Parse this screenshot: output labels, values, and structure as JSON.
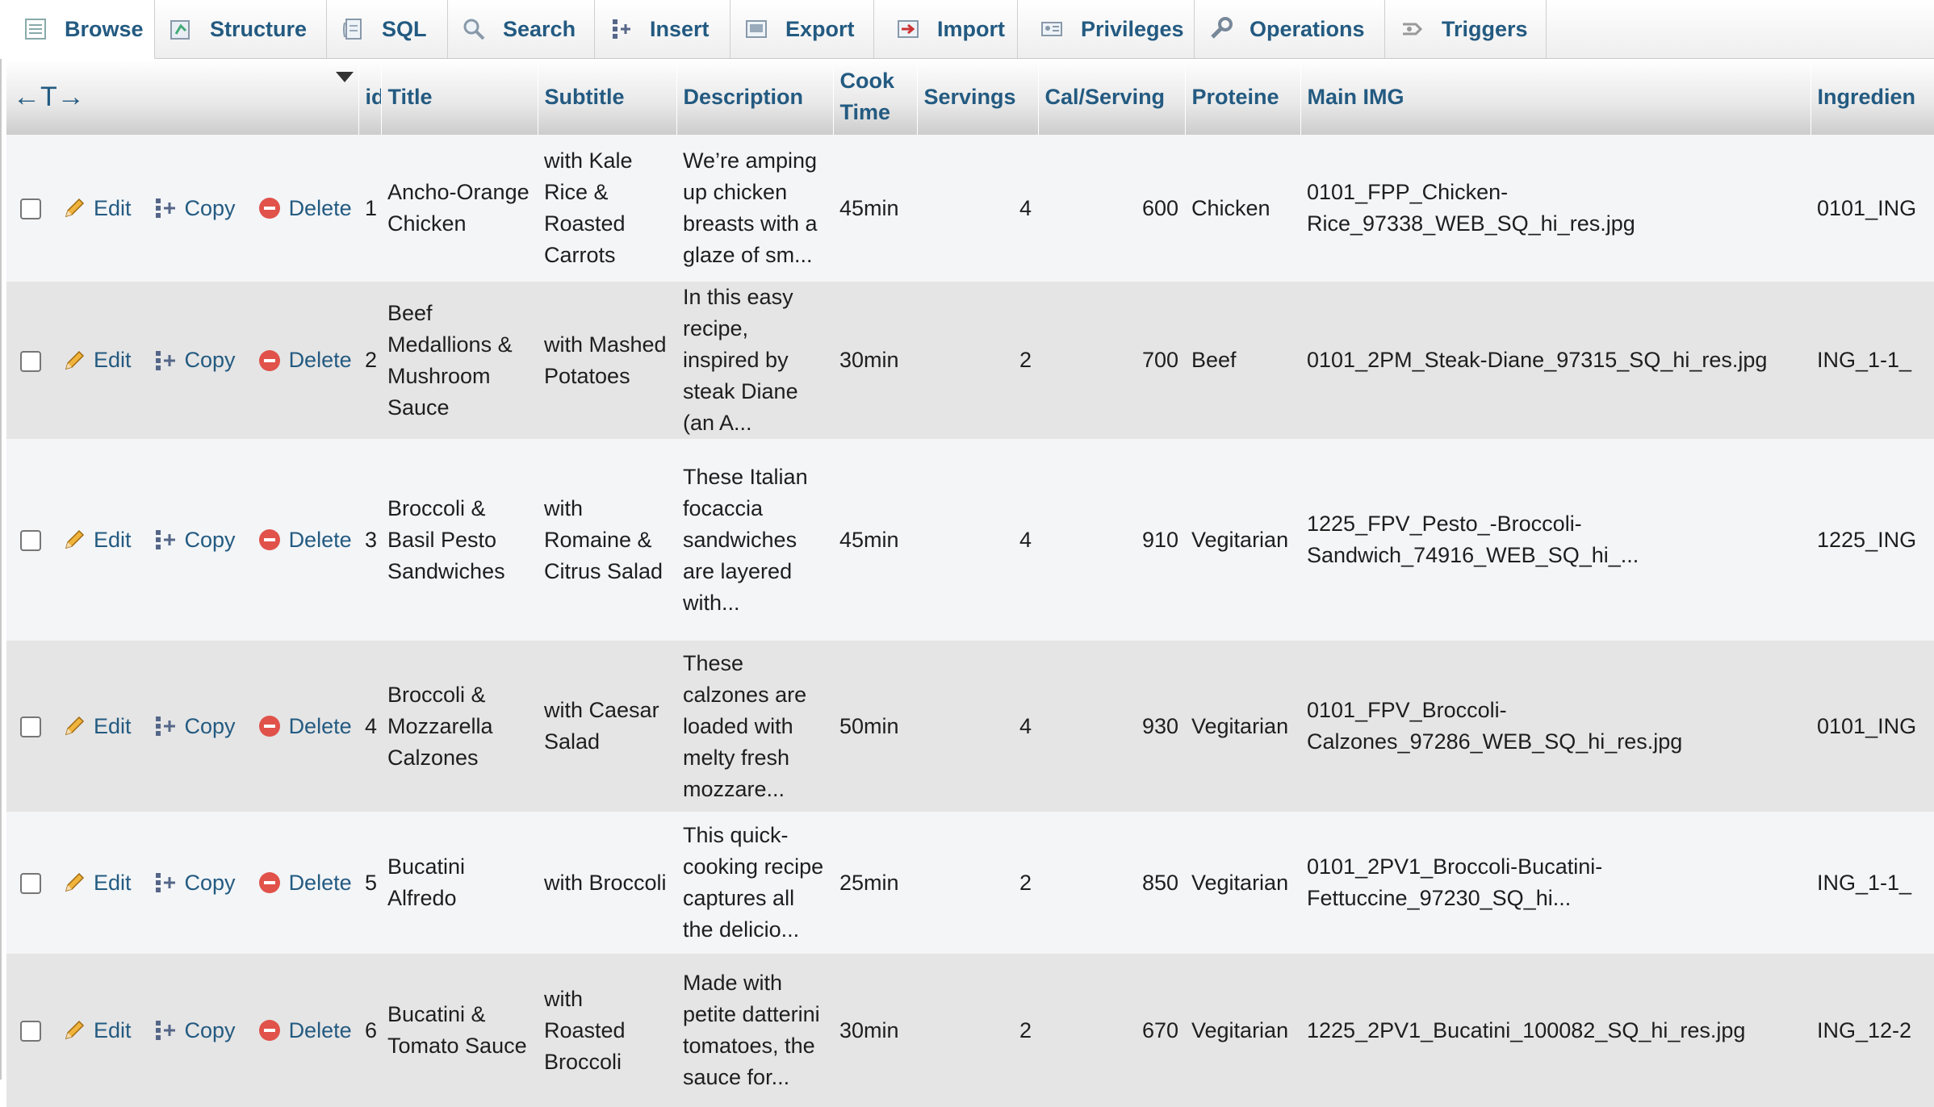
{
  "tabs": [
    {
      "label": "Browse",
      "icon": "browse-icon",
      "active": true
    },
    {
      "label": "Structure",
      "icon": "structure-icon"
    },
    {
      "label": "SQL",
      "icon": "sql-icon"
    },
    {
      "label": "Search",
      "icon": "search-icon"
    },
    {
      "label": "Insert",
      "icon": "insert-icon"
    },
    {
      "label": "Export",
      "icon": "export-icon"
    },
    {
      "label": "Import",
      "icon": "import-icon"
    },
    {
      "label": "Privileges",
      "icon": "privileges-icon"
    },
    {
      "label": "Operations",
      "icon": "operations-icon"
    },
    {
      "label": "Triggers",
      "icon": "triggers-icon"
    }
  ],
  "table": {
    "resize_glyph": "←T→",
    "columns": {
      "id": "id",
      "title": "Title",
      "subtitle": "Subtitle",
      "description": "Description",
      "cook_time": "Cook Time",
      "servings": "Servings",
      "cal_serving": "Cal/Serving",
      "proteine": "Proteine",
      "main_img": "Main IMG",
      "ingredients": "Ingredien"
    },
    "actions": {
      "edit": "Edit",
      "copy": "Copy",
      "delete": "Delete"
    },
    "rows": [
      {
        "id": "1",
        "title": "Ancho-Orange Chicken",
        "subtitle": "with Kale Rice & Roasted Carrots",
        "description": "We’re amping up chicken breasts with a glaze of sm...",
        "cook_time": "45min",
        "servings": "4",
        "cal": "600",
        "proteine": "Chicken",
        "main_img": "0101_FPP_Chicken-Rice_97338_WEB_SQ_hi_res.jpg",
        "ingredients": "0101_ING"
      },
      {
        "id": "2",
        "title": "Beef Medallions & Mushroom Sauce",
        "subtitle": "with Mashed Potatoes",
        "description": "In this easy recipe, inspired by steak Diane (an A...",
        "cook_time": "30min",
        "servings": "2",
        "cal": "700",
        "proteine": "Beef",
        "main_img": "0101_2PM_Steak-Diane_97315_SQ_hi_res.jpg",
        "ingredients": "ING_1-1_"
      },
      {
        "id": "3",
        "title": "Broccoli & Basil Pesto Sandwiches",
        "subtitle": "with Romaine & Citrus Salad",
        "description": "These Italian focaccia sandwiches are layered with...",
        "cook_time": "45min",
        "servings": "4",
        "cal": "910",
        "proteine": "Vegitarian",
        "main_img": "1225_FPV_Pesto_-Broccoli-Sandwich_74916_WEB_SQ_hi_...",
        "ingredients": "1225_ING"
      },
      {
        "id": "4",
        "title": "Broccoli & Mozzarella Calzones",
        "subtitle": "with Caesar Salad",
        "description": "These calzones are loaded with melty fresh mozzare...",
        "cook_time": "50min",
        "servings": "4",
        "cal": "930",
        "proteine": "Vegitarian",
        "main_img": "0101_FPV_Broccoli-Calzones_97286_WEB_SQ_hi_res.jpg",
        "ingredients": "0101_ING"
      },
      {
        "id": "5",
        "title": "Bucatini Alfredo",
        "subtitle": "with Broccoli",
        "description": "This quick-cooking recipe captures all the delicio...",
        "cook_time": "25min",
        "servings": "2",
        "cal": "850",
        "proteine": "Vegitarian",
        "main_img": "0101_2PV1_Broccoli-Bucatini-Fettuccine_97230_SQ_hi...",
        "ingredients": "ING_1-1_"
      },
      {
        "id": "6",
        "title": "Bucatini & Tomato Sauce",
        "subtitle": "with Roasted Broccoli",
        "description": "Made with petite datterini tomatoes, the sauce for...",
        "cook_time": "30min",
        "servings": "2",
        "cal": "670",
        "proteine": "Vegitarian",
        "main_img": "1225_2PV1_Bucatini_100082_SQ_hi_res.jpg",
        "ingredients": "ING_12-2"
      }
    ]
  }
}
